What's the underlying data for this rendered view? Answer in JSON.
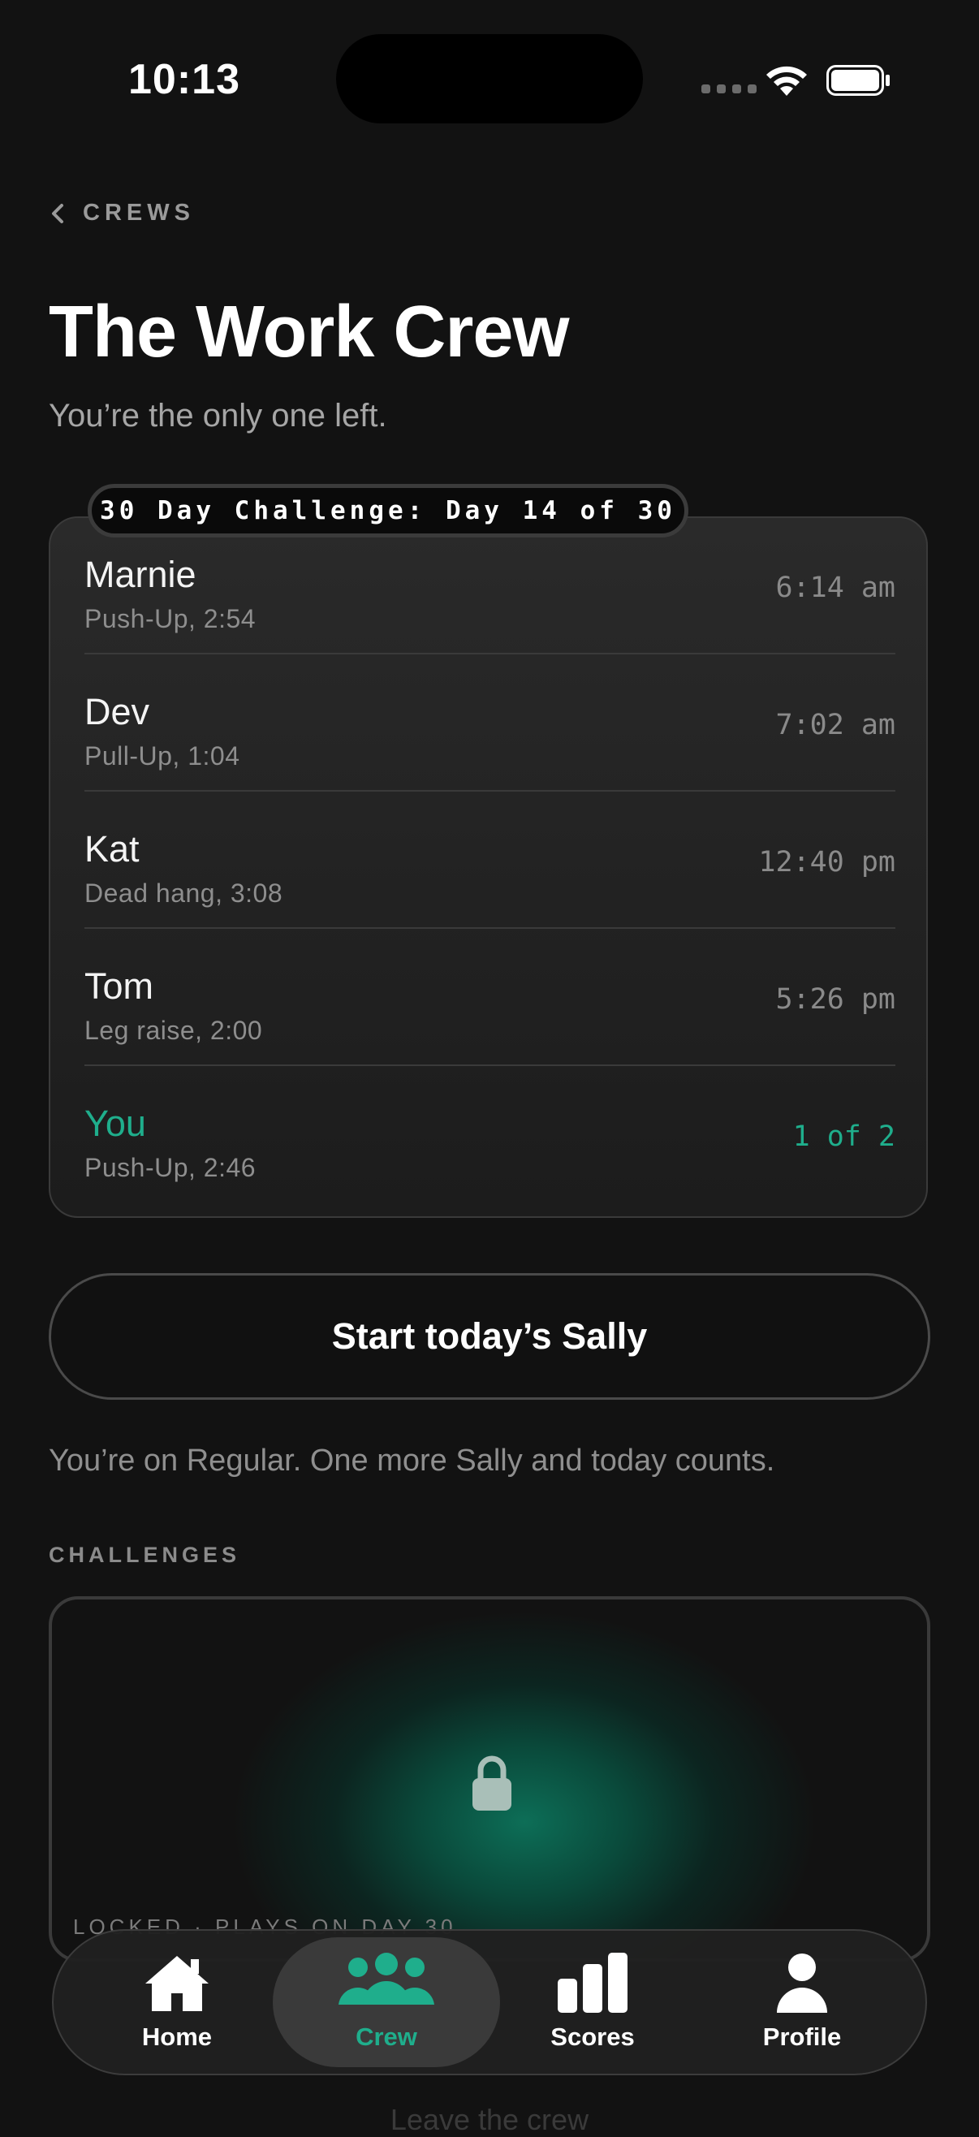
{
  "status_bar": {
    "time": "10:13"
  },
  "header": {
    "back_label": "CREWS",
    "title": "The Work Crew",
    "subtitle": "You’re the only one left."
  },
  "challenge_tag": "30 Day Challenge: Day 14 of 30",
  "members": [
    {
      "name": "Marnie",
      "detail": "Push-Up, 2:54",
      "time": "6:14 am"
    },
    {
      "name": "Dev",
      "detail": "Pull-Up, 1:04",
      "time": "7:02 am"
    },
    {
      "name": "Kat",
      "detail": "Dead hang, 3:08",
      "time": "12:40 pm"
    },
    {
      "name": "Tom",
      "detail": "Leg raise, 2:00",
      "time": "5:26 pm"
    },
    {
      "name": "You",
      "detail": "Push-Up, 2:46",
      "time": "1 of 2"
    }
  ],
  "cta_label": "Start today’s Sally",
  "note": "You’re on Regular. One more Sally and today counts.",
  "section_title": "CHALLENGES",
  "locked_caption": "LOCKED · PLAYS ON DAY 30",
  "faded_text": "Leave the crew",
  "tabs": [
    {
      "label": "Home",
      "icon": "house-icon"
    },
    {
      "label": "Crew",
      "icon": "people-icon",
      "active": true
    },
    {
      "label": "Scores",
      "icon": "bar-chart-icon"
    },
    {
      "label": "Profile",
      "icon": "person-icon"
    }
  ],
  "colors": {
    "accent": "#1fae8c",
    "background": "#121212"
  }
}
